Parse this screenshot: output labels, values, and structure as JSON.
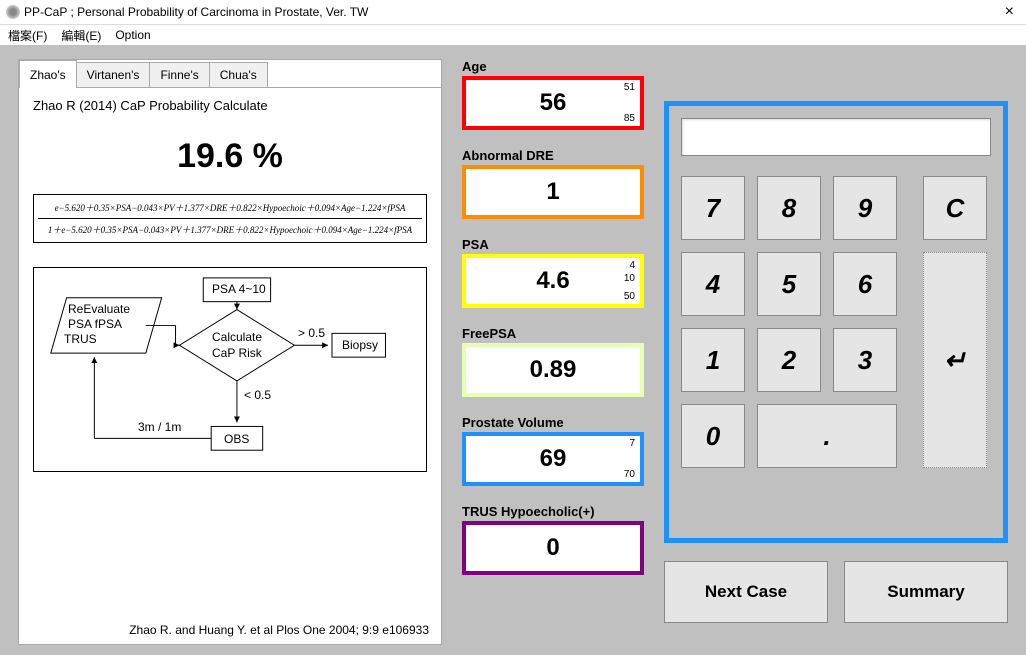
{
  "window": {
    "title": "PP-CaP ; Personal Probability of Carcinoma in Prostate, Ver. TW"
  },
  "menu": {
    "file": "檔案(F)",
    "edit": "編輯(E)",
    "option": "Option"
  },
  "tabs": {
    "zhao": "Zhao's",
    "virtanen": "Virtanen's",
    "finne": "Finne's",
    "chua": "Chua's"
  },
  "panel": {
    "title": "Zhao R (2014) CaP Probability Calculate",
    "percent": "19.6 %",
    "formula_num": "e−5.620＋0.35×PSA−0.043×PV＋1.377×DRE＋0.822×Hypoechoic＋0.094×Age−1.224×fPSA",
    "formula_den": "1＋e−5.620＋0.35×PSA−0.043×PV＋1.377×DRE＋0.822×Hypoechoic＋0.094×Age−1.224×fPSA",
    "citation": "Zhao R.  and Huang Y. et al   Plos One 2004; 9:9 e106933"
  },
  "flow": {
    "psa_range": "PSA 4~10",
    "reeval1": "ReEvaluate",
    "reeval2": "PSA  fPSA",
    "reeval3": "TRUS",
    "calc1": "Calculate",
    "calc2": "CaP Risk",
    "gt": "> 0.5",
    "lt": "< 0.5",
    "biopsy": "Biopsy",
    "obs": "OBS",
    "loop": "3m / 1m"
  },
  "inputs": {
    "age": {
      "label": "Age",
      "value": "56",
      "min": "51",
      "max": "85"
    },
    "dre": {
      "label": "Abnormal DRE",
      "value": "1"
    },
    "psa": {
      "label": "PSA",
      "value": "4.6",
      "min": "4",
      "mid": "10",
      "max": "50"
    },
    "fpsa": {
      "label": "FreePSA",
      "value": "0.89"
    },
    "pv": {
      "label": "Prostate Volume",
      "value": "69",
      "min": "7",
      "max": "70"
    },
    "hypo": {
      "label": "TRUS Hypoecholic(+)",
      "value": "0"
    }
  },
  "keys": {
    "k7": "7",
    "k8": "8",
    "k9": "9",
    "kc": "C",
    "k4": "4",
    "k5": "5",
    "k6": "6",
    "k1": "1",
    "k2": "2",
    "k3": "3",
    "k0": "0",
    "kdot": ".",
    "kenter": "↵"
  },
  "actions": {
    "next": "Next Case",
    "summary": "Summary"
  }
}
